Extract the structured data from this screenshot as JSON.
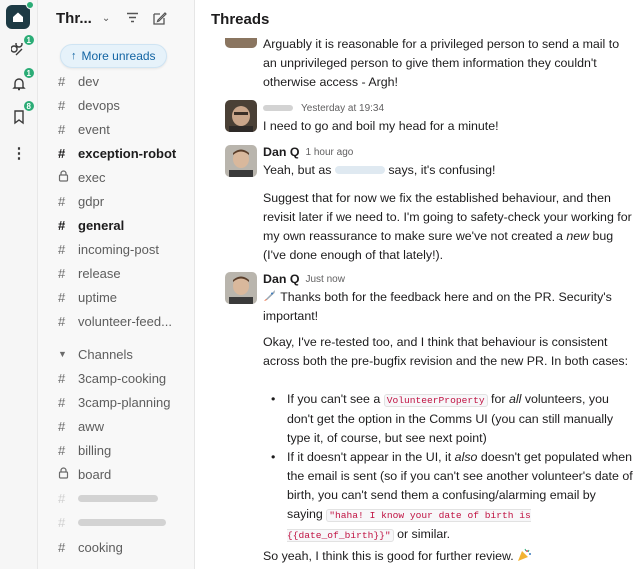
{
  "rail": {
    "home_icon": "workspace-home-icon",
    "items": [
      {
        "icon": "threads-icon",
        "badge": "1"
      },
      {
        "icon": "bell-icon",
        "badge": "1"
      },
      {
        "icon": "bookmark-icon",
        "badge": "8"
      },
      {
        "icon": "more-icon",
        "badge": ""
      }
    ],
    "accent": "#2bac76"
  },
  "sidebar": {
    "title": "Thr...",
    "more_unreads": "More unreads",
    "channels": [
      {
        "sym": "#",
        "name": "dev",
        "bold": false
      },
      {
        "sym": "#",
        "name": "devops",
        "bold": false
      },
      {
        "sym": "#",
        "name": "event",
        "bold": false
      },
      {
        "sym": "#",
        "name": "exception-robot",
        "bold": true
      },
      {
        "sym": "lock",
        "name": "exec",
        "bold": false
      },
      {
        "sym": "#",
        "name": "gdpr",
        "bold": false
      },
      {
        "sym": "#",
        "name": "general",
        "bold": true
      },
      {
        "sym": "#",
        "name": "incoming-post",
        "bold": false
      },
      {
        "sym": "#",
        "name": "release",
        "bold": false
      },
      {
        "sym": "#",
        "name": "uptime",
        "bold": false
      },
      {
        "sym": "#",
        "name": "volunteer-feed...",
        "bold": false
      }
    ],
    "section_label": "Channels",
    "section_channels": [
      {
        "sym": "#",
        "name": "3camp-cooking"
      },
      {
        "sym": "#",
        "name": "3camp-planning"
      },
      {
        "sym": "#",
        "name": "aww"
      },
      {
        "sym": "#",
        "name": "billing"
      },
      {
        "sym": "lock",
        "name": "board"
      }
    ],
    "last_channel": {
      "sym": "#",
      "name": "cooking"
    }
  },
  "main": {
    "title": "Threads",
    "messages": [
      {
        "text": "Arguably it is reasonable for a privileged person to send a mail to an unprivileged person to give them information they couldn't otherwise access - Argh!"
      },
      {
        "time": "Yesterday at 19:34",
        "text": "I need to go and boil my head for a minute!"
      },
      {
        "author": "Dan Q",
        "time": "1 hour ago",
        "text_before": "Yeah, but as",
        "text_after": "says, it's confusing!",
        "p2_a": "Suggest that for now we fix the established behaviour, and then revisit later if we need to. I'm going to safety-check your working for my own reassurance to make sure we've not created a ",
        "p2_em": "new",
        "p2_b": " bug (I've done enough of that lately!)."
      },
      {
        "author": "Dan Q",
        "time": "Just now",
        "p1": "Thanks both for the feedback here and on the PR. Security's important!",
        "p2": "Okay, I've re-tested too, and I think that behaviour is consistent across both the pre-bugfix revision and the new PR. In both cases:",
        "b1_a": "If you can't see a ",
        "b1_code": "VolunteerProperty",
        "b1_b": " for ",
        "b1_em": "all",
        "b1_c": " volunteers, you don't get the option in the Comms UI (you can still manually type it, of course, but see next point)",
        "b2_a": "If it doesn't appear in the UI, it ",
        "b2_em": "also",
        "b2_b": " doesn't get populated when the email is sent (so if you can't see another volunteer's date of birth, you can't send them a confusing/alarming email by saying ",
        "b2_code": "\"haha! I know your date of birth is {{date_of_birth}}\"",
        "b2_c": " or similar.",
        "p3": "So yeah, I think this is good for further review."
      }
    ]
  }
}
